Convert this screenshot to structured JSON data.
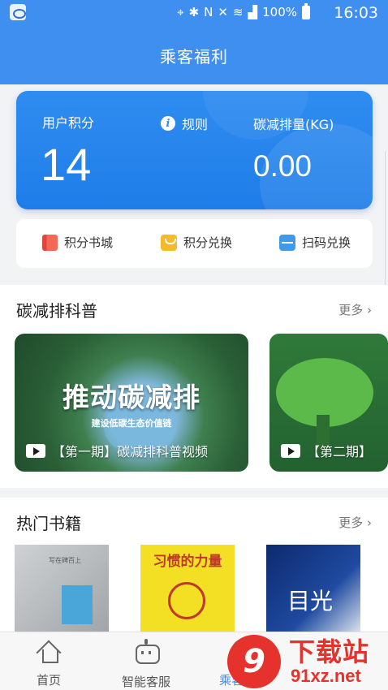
{
  "status_bar": {
    "battery": "100%",
    "time": "16:03",
    "icons": [
      "location-icon",
      "bluetooth-icon",
      "nfc-icon",
      "mute-icon",
      "wifi-icon",
      "signal-icon",
      "battery-icon"
    ]
  },
  "header": {
    "title": "乘客福利"
  },
  "points_card": {
    "points_label": "用户积分",
    "points_value": "14",
    "rule_label": "规则",
    "carbon_label": "碳减排量(KG)",
    "carbon_value": "0.00"
  },
  "quick_actions": [
    {
      "label": "积分书城",
      "icon": "book-icon"
    },
    {
      "label": "积分兑换",
      "icon": "shopping-bag-icon"
    },
    {
      "label": "扫码兑换",
      "icon": "scan-icon"
    }
  ],
  "science": {
    "title": "碳减排科普",
    "more": "更多 ›",
    "videos": [
      {
        "cover_title": "推动碳减排",
        "cover_subtitle": "建设低碳生态价值链",
        "caption": "【第一期】碳减排科普视频"
      },
      {
        "caption": "【第二期】"
      }
    ]
  },
  "books": {
    "title": "热门书籍",
    "more": "更多 ›",
    "items": [
      {
        "cover_text": "写在碑百上"
      },
      {
        "cover_text": "习惯的力量"
      },
      {
        "cover_text": "目光"
      }
    ]
  },
  "tabbar": [
    {
      "label": "首页",
      "icon": "home-icon"
    },
    {
      "label": "智能客服",
      "icon": "robot-icon"
    },
    {
      "label": "乘客福利",
      "icon": "rider-icon"
    }
  ],
  "watermark": {
    "title": "下载站",
    "url": "91xz.net",
    "badge": "9"
  },
  "colors": {
    "primary": "#3f8ff0",
    "watermark_red": "#e5322c"
  }
}
